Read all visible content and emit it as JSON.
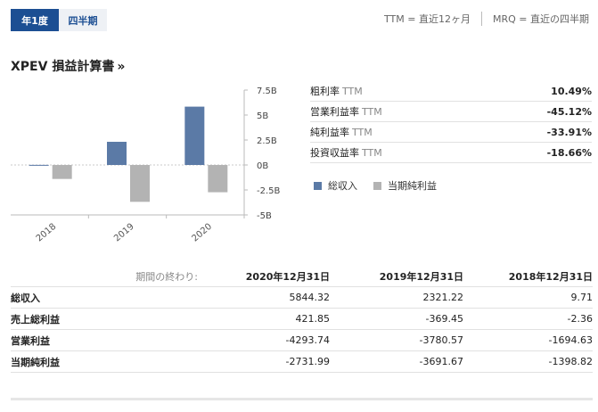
{
  "tabs": [
    {
      "label": "年1度",
      "active": true
    },
    {
      "label": "四半期",
      "active": false
    }
  ],
  "ttm_info": {
    "ttm": "TTM = 直近12ヶ月",
    "mrq": "MRQ = 直近の四半期"
  },
  "title": "XPEV 損益計算書",
  "title_chevron": "»",
  "chart_data": {
    "type": "bar",
    "categories": [
      "2018",
      "2019",
      "2020"
    ],
    "series": [
      {
        "name": "総収入",
        "values": [
          0.01,
          2.32,
          5.84
        ],
        "color": "#5b7aa6"
      },
      {
        "name": "当期純利益",
        "values": [
          -1.4,
          -3.69,
          -2.73
        ],
        "color": "#b3b3b3"
      }
    ],
    "yticks": [
      "7.5B",
      "5B",
      "2.5B",
      "0B",
      "-2.5B",
      "-5B"
    ],
    "ylim": [
      -5,
      7.5
    ]
  },
  "ratios": [
    {
      "label": "粗利率",
      "sub": "TTM",
      "value": "10.49%"
    },
    {
      "label": "営業利益率",
      "sub": "TTM",
      "value": "-45.12%"
    },
    {
      "label": "純利益率",
      "sub": "TTM",
      "value": "-33.91%"
    },
    {
      "label": "投資収益率",
      "sub": "TTM",
      "value": "-18.66%"
    }
  ],
  "legend": [
    {
      "label": "総収入",
      "color": "#5b7aa6"
    },
    {
      "label": "当期純利益",
      "color": "#b3b3b3"
    }
  ],
  "table": {
    "period_label": "期間の終わり:",
    "columns": [
      "2020年12月31日",
      "2019年12月31日",
      "2018年12月31日"
    ],
    "rows": [
      {
        "label": "総収入",
        "values": [
          "5844.32",
          "2321.22",
          "9.71"
        ]
      },
      {
        "label": "売上総利益",
        "values": [
          "421.85",
          "-369.45",
          "-2.36"
        ]
      },
      {
        "label": "営業利益",
        "values": [
          "-4293.74",
          "-3780.57",
          "-1694.63"
        ]
      },
      {
        "label": "当期純利益",
        "values": [
          "-2731.99",
          "-3691.67",
          "-1398.82"
        ]
      }
    ]
  }
}
